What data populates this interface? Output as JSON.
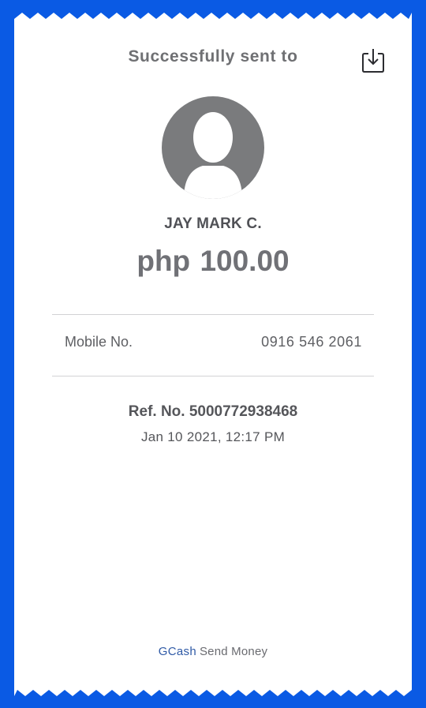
{
  "colors": {
    "background": "#0a5ae4",
    "receipt": "#ffffff",
    "brand": "#2f5aa6",
    "avatar": "#7a7b7d"
  },
  "header": {
    "title": "Successfully sent to",
    "download_icon": "download-icon"
  },
  "recipient": {
    "avatar_icon": "user-avatar-icon",
    "name": "JAY MARK C.",
    "currency": "php",
    "amount": "100.00"
  },
  "details": {
    "mobile_label": "Mobile No.",
    "mobile_value": "0916 546 2061"
  },
  "reference": {
    "ref_text": "Ref. No. 5000772938468",
    "datetime": "Jan 10 2021, 12:17 PM"
  },
  "footer": {
    "brand": "GCash",
    "text": "Send Money"
  }
}
